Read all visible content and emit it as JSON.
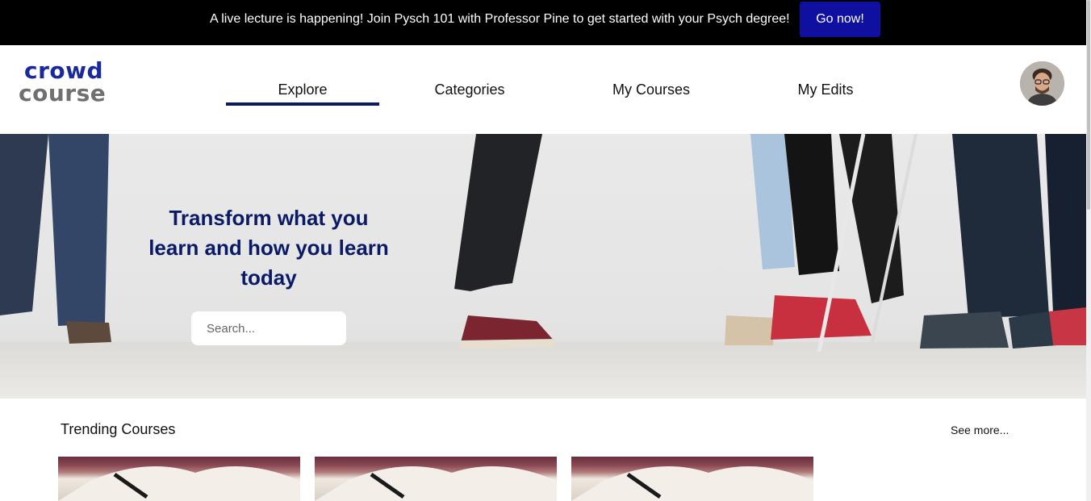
{
  "announcement": {
    "text": "A live lecture is happening! Join Pysch 101 with Professor Pine to get started with your Psych degree!",
    "button_label": "Go now!"
  },
  "logo": {
    "line1": "crowd",
    "line2": "course"
  },
  "nav": {
    "items": [
      {
        "label": "Explore",
        "active": true
      },
      {
        "label": "Categories",
        "active": false
      },
      {
        "label": "My Courses",
        "active": false
      },
      {
        "label": "My Edits",
        "active": false
      }
    ]
  },
  "hero": {
    "title": "Transform what you learn and how you learn today",
    "search_placeholder": "Search..."
  },
  "trending": {
    "title": "Trending Courses",
    "see_more": "See more..."
  },
  "colors": {
    "accent": "#0b1a66",
    "button": "#1010a0",
    "logo_blue": "#1a2a9a",
    "logo_gray": "#707070"
  }
}
